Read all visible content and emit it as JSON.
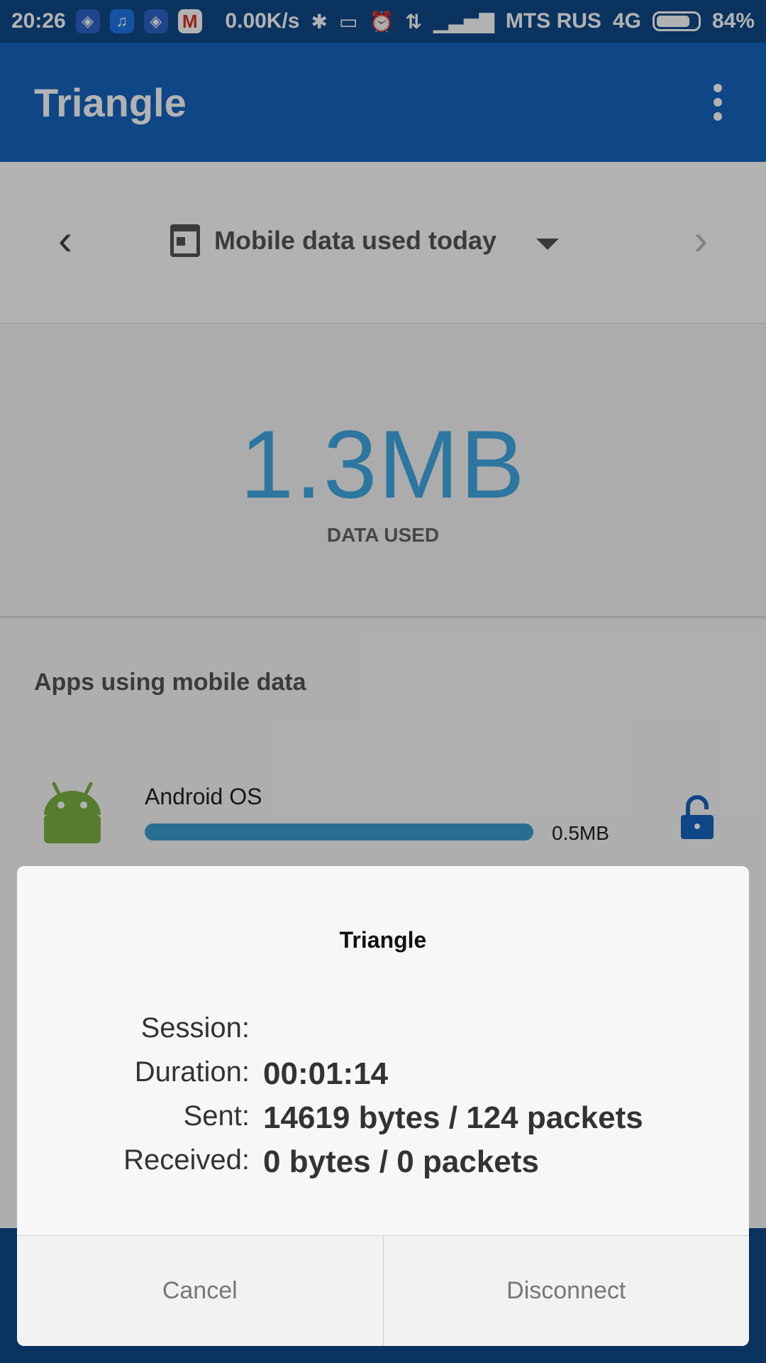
{
  "status_bar": {
    "time": "20:26",
    "net_speed": "0.00K/s",
    "carrier": "MTS RUS",
    "network_type": "4G",
    "battery_percent": "84%",
    "battery_level": 0.84,
    "icons": [
      "vpn-shield-icon",
      "music-icon",
      "vpn-shield-icon",
      "gmail-icon",
      "bluetooth-icon",
      "vibrate-icon",
      "alarm-icon",
      "data-transfer-icon",
      "signal-icon",
      "battery-icon"
    ]
  },
  "app_bar": {
    "title": "Triangle",
    "menu_icon": "more-vert-icon"
  },
  "period_selector": {
    "label": "Mobile data used today",
    "icon": "calendar-icon",
    "prev_icon": "chevron-left-icon",
    "next_icon": "chevron-right-icon",
    "dropdown_icon": "dropdown-caret-icon"
  },
  "usage": {
    "value": "1.3MB",
    "label": "DATA USED"
  },
  "apps_section": {
    "title": "Apps using mobile data",
    "items": [
      {
        "name": "Android OS",
        "size": "0.5MB",
        "icon": "android-icon",
        "action_icon": "lock-open-icon",
        "usage_fraction": 1.0
      }
    ]
  },
  "dialog": {
    "title": "Triangle",
    "rows": [
      {
        "key": "Session:",
        "value": ""
      },
      {
        "key": "Duration:",
        "value": "00:01:14"
      },
      {
        "key": "Sent:",
        "value": "14619 bytes / 124 packets"
      },
      {
        "key": "Received:",
        "value": "0 bytes / 0 packets"
      }
    ],
    "cancel_label": "Cancel",
    "disconnect_label": "Disconnect"
  },
  "colors": {
    "status_bar": "#0f4a8a",
    "app_bar": "#1565c0",
    "accent_blue": "#3fa9e6",
    "usage_bar": "#3d9ed2",
    "android_green": "#7cb342"
  }
}
